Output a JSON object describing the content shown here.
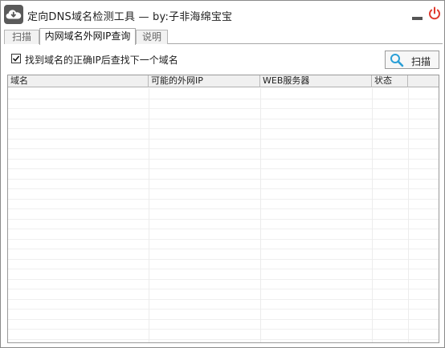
{
  "window": {
    "title": "定向DNS域名检测工具 — by:子非海绵宝宝",
    "icon": "cloud-icon"
  },
  "title_buttons": {
    "minimize_icon": "minimize-icon",
    "close_icon": "power-icon",
    "close_color": "#e03a2e"
  },
  "tabs": [
    {
      "label": "扫描",
      "active": false
    },
    {
      "label": "内网域名外网IP查询",
      "active": true
    },
    {
      "label": "说明",
      "active": false
    }
  ],
  "options": {
    "stop_on_found": {
      "label": "找到域名的正确IP后查找下一个域名",
      "checked": true
    }
  },
  "scan_button": {
    "label": "扫描",
    "icon": "search-icon",
    "accent": "#2a9fd6"
  },
  "table": {
    "columns": [
      "域名",
      "可能的外网IP",
      "WEB服务器",
      "状态",
      ""
    ],
    "rows": []
  }
}
